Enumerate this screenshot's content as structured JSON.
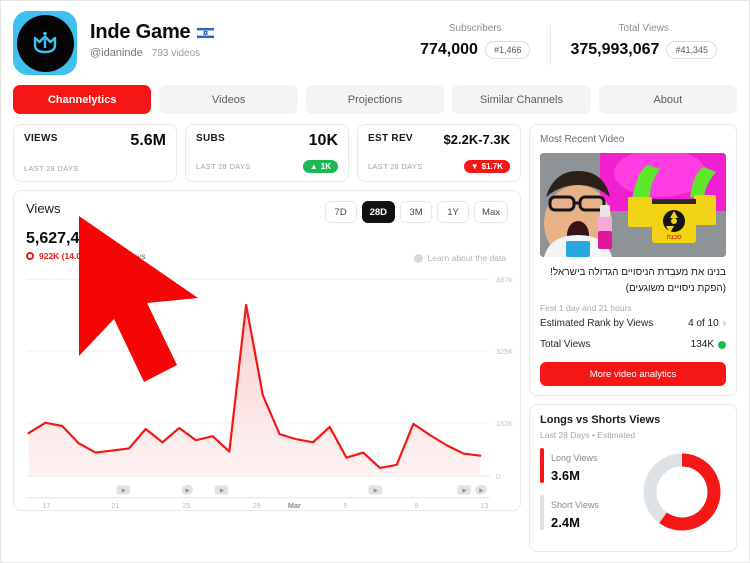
{
  "channel": {
    "name": "Inde Game",
    "flag_icon": "israel-flag-icon",
    "handle": "@idaninde",
    "videos": "793 videos",
    "avatar_icon": "channel-avatar-crown-icon",
    "avatar_bg": "#3ec0f0"
  },
  "header_stats": [
    {
      "label": "Subscribers",
      "value": "774,000",
      "rank": "#1,466"
    },
    {
      "label": "Total Views",
      "value": "375,993,067",
      "rank": "#41,345"
    }
  ],
  "tabs": [
    {
      "label": "Channelytics",
      "active": true
    },
    {
      "label": "Videos",
      "active": false
    },
    {
      "label": "Projections",
      "active": false
    },
    {
      "label": "Similar Channels",
      "active": false
    },
    {
      "label": "About",
      "active": false
    }
  ],
  "cards": [
    {
      "label": "VIEWS",
      "value": "5.6M",
      "sub": "LAST 28 DAYS",
      "delta": "",
      "delta_dir": ""
    },
    {
      "label": "SUBS",
      "value": "10K",
      "sub": "LAST 28 DAYS",
      "delta": "1K",
      "delta_dir": "up"
    },
    {
      "label": "EST REV",
      "value": "$2.2K-7.3K",
      "sub": "LAST 28 DAYS",
      "delta": "$1.7K",
      "delta_dir": "down"
    }
  ],
  "chart_panel": {
    "title": "Views",
    "total": "5,627,4",
    "delta": "922K (14.0%)",
    "period": "Past 28 days",
    "learn_link": "Learn about the data",
    "info_icon": "info-circle-icon",
    "ranges": [
      {
        "label": "7D",
        "active": false
      },
      {
        "label": "28D",
        "active": true
      },
      {
        "label": "3M",
        "active": false
      },
      {
        "label": "1Y",
        "active": false
      },
      {
        "label": "Max",
        "active": false
      }
    ]
  },
  "chart_data": {
    "type": "area",
    "title": "Views",
    "xlabel": "",
    "ylabel": "Views",
    "ylim": [
      0,
      487000
    ],
    "yticks": [
      "0",
      "162K",
      "325K",
      "487K"
    ],
    "ytick_values": [
      0,
      162000,
      325000,
      487000
    ],
    "xticks": [
      "17",
      "21",
      "25",
      "29",
      "Mar",
      "5",
      "9",
      "13"
    ],
    "grid": true,
    "legend": "none",
    "line_color": "#f51616",
    "fill_color": "#fbdbdb",
    "x": [
      "16",
      "17",
      "18",
      "19",
      "20",
      "21",
      "22",
      "23",
      "24",
      "25",
      "26",
      "27",
      "28",
      "29",
      "1",
      "2",
      "3",
      "4",
      "5",
      "6",
      "7",
      "8",
      "9",
      "10",
      "11",
      "12",
      "13",
      "14"
    ],
    "values": [
      207000,
      232000,
      225000,
      186000,
      165000,
      168000,
      172000,
      215000,
      185000,
      220000,
      193000,
      203000,
      163000,
      380000,
      272000,
      195000,
      183000,
      176000,
      210000,
      155000,
      163000,
      138000,
      143000,
      228000,
      202000,
      181000,
      166000,
      161000,
      168000
    ],
    "video_markers": [
      {
        "x_index": 5,
        "icon": "video-marker-icon"
      },
      {
        "x_index": 9,
        "icon": "shorts-marker-icon"
      },
      {
        "x_index": 11,
        "icon": "video-marker-icon"
      },
      {
        "x_index": 19,
        "icon": "video-marker-icon"
      },
      {
        "x_index": 25,
        "icon": "video-marker-icon"
      },
      {
        "x_index": 27,
        "icon": "shorts-marker-icon"
      }
    ]
  },
  "recent_video": {
    "panel_title": "Most Recent Video",
    "thumb_icon": "video-thumbnail",
    "title": "בנינו את מעבדת הניסויים הגדולה בישראל! (הפקת ניסויים משוגעים)",
    "first_seen": "First 1 day and 21 hours",
    "rank_label": "Estimated Rank by Views",
    "rank_value": "4 of 10",
    "views_label": "Total Views",
    "views_value": "134K",
    "cta": "More video analytics"
  },
  "longs_shorts": {
    "title": "Longs vs Shorts Views",
    "subtitle": "Last 28 Days • Estimated",
    "long_label": "Long Views",
    "long_value": "3.6M",
    "short_label": "Short Views",
    "short_value": "2.4M",
    "donut_pct": 60,
    "long_color": "#f51616",
    "short_color": "#dee2e4"
  },
  "cursor": {
    "icon": "mouse-cursor-arrow",
    "color": "#f40606"
  }
}
